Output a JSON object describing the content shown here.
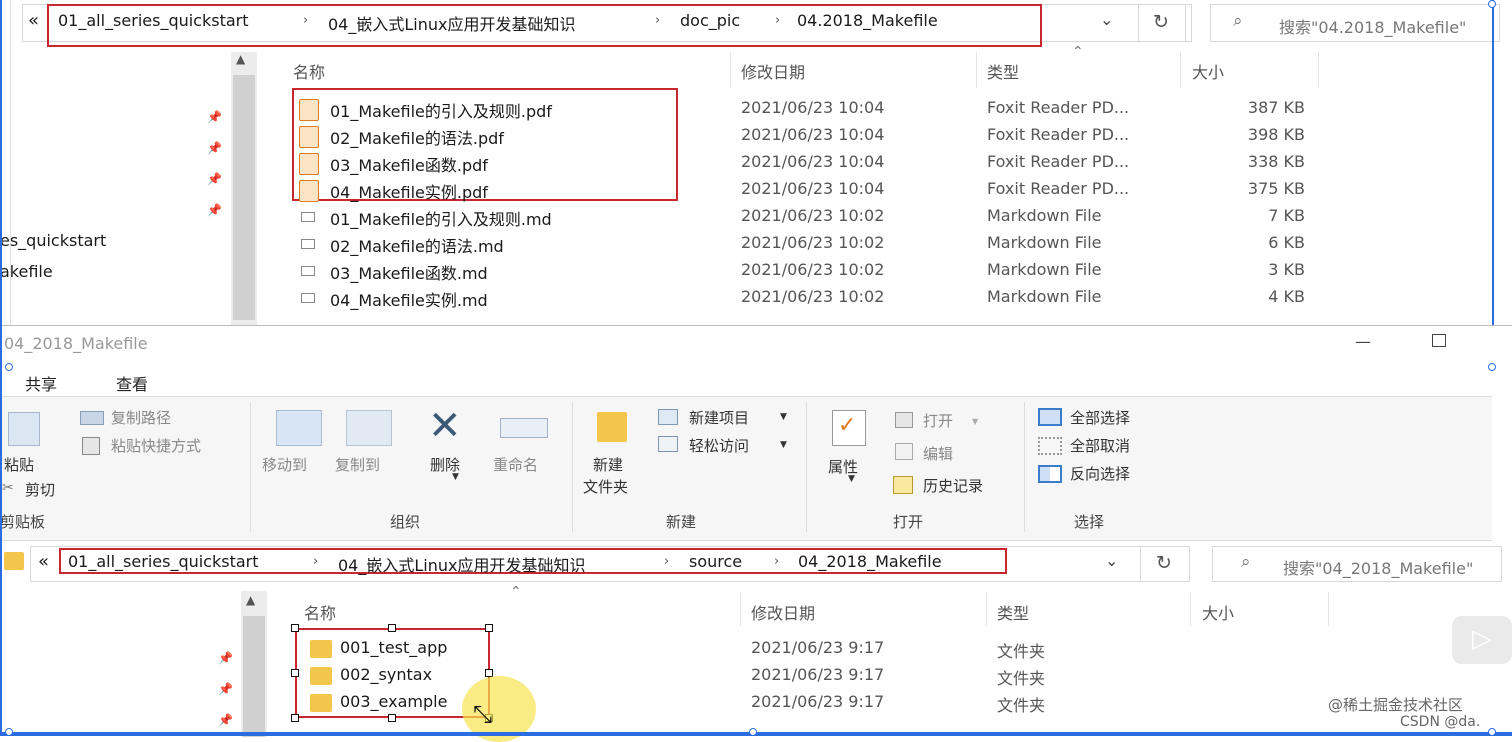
{
  "top": {
    "breadcrumb": [
      "01_all_series_quickstart",
      "04_嵌入式Linux应用开发基础知识",
      "doc_pic",
      "04.2018_Makefile"
    ],
    "back_chevrons": "«",
    "search_placeholder": "搜索\"04.2018_Makefile\"",
    "columns": {
      "name": "名称",
      "date": "修改日期",
      "type": "类型",
      "size": "大小"
    },
    "side_labels": [
      "es_quickstart",
      "akefile"
    ],
    "files": [
      {
        "name": "01_Makefile的引入及规则.pdf",
        "date": "2021/06/23 10:04",
        "type": "Foxit Reader PD...",
        "size": "387 KB",
        "icon": "pdf-icon"
      },
      {
        "name": "02_Makefile的语法.pdf",
        "date": "2021/06/23 10:04",
        "type": "Foxit Reader PD...",
        "size": "398 KB",
        "icon": "pdf-icon"
      },
      {
        "name": "03_Makefile函数.pdf",
        "date": "2021/06/23 10:04",
        "type": "Foxit Reader PD...",
        "size": "338 KB",
        "icon": "pdf-icon"
      },
      {
        "name": "04_Makefile实例.pdf",
        "date": "2021/06/23 10:04",
        "type": "Foxit Reader PD...",
        "size": "375 KB",
        "icon": "pdf-icon"
      },
      {
        "name": "01_Makefile的引入及规则.md",
        "date": "2021/06/23 10:02",
        "type": "Markdown File",
        "size": "7 KB",
        "icon": "md-icon"
      },
      {
        "name": "02_Makefile的语法.md",
        "date": "2021/06/23 10:02",
        "type": "Markdown File",
        "size": "6 KB",
        "icon": "md-icon"
      },
      {
        "name": "03_Makefile函数.md",
        "date": "2021/06/23 10:02",
        "type": "Markdown File",
        "size": "3 KB",
        "icon": "md-icon"
      },
      {
        "name": "04_Makefile实例.md",
        "date": "2021/06/23 10:02",
        "type": "Markdown File",
        "size": "4 KB",
        "icon": "md-icon"
      }
    ]
  },
  "bottom": {
    "window_title": "04_2018_Makefile",
    "tabs": [
      "共享",
      "查看"
    ],
    "ribbon": {
      "clipboard": {
        "copy_path": "复制路径",
        "paste_shortcut": "粘贴快捷方式",
        "paste": "粘贴",
        "cut": "剪切",
        "group": "剪贴板"
      },
      "organize": {
        "move_to": "移动到",
        "copy_to": "复制到",
        "delete": "删除",
        "rename": "重命名",
        "group": "组织"
      },
      "new": {
        "new_item": "新建项目",
        "easy_access": "轻松访问",
        "new_folder_1": "新建",
        "new_folder_2": "文件夹",
        "group": "新建"
      },
      "open": {
        "properties": "属性",
        "open": "打开",
        "edit": "编辑",
        "history": "历史记录",
        "group": "打开"
      },
      "select": {
        "select_all": "全部选择",
        "select_none": "全部取消",
        "invert": "反向选择",
        "group": "选择"
      }
    },
    "breadcrumb": [
      "01_all_series_quickstart",
      "04_嵌入式Linux应用开发基础知识",
      "source",
      "04_2018_Makefile"
    ],
    "back_chevrons": "«",
    "search_placeholder": "搜索\"04_2018_Makefile\"",
    "columns": {
      "name": "名称",
      "date": "修改日期",
      "type": "类型",
      "size": "大小"
    },
    "folders": [
      {
        "name": "001_test_app",
        "date": "2021/06/23 9:17",
        "type": "文件夹"
      },
      {
        "name": "002_syntax",
        "date": "2021/06/23 9:17",
        "type": "文件夹"
      },
      {
        "name": "003_example",
        "date": "2021/06/23 9:17",
        "type": "文件夹"
      }
    ]
  },
  "watermark": {
    "line1": "@稀土掘金技术社区",
    "line2": "CSDN @da."
  },
  "colors": {
    "accent_border": "#c8282d",
    "selection_handle": "#2a6de0",
    "folder": "#f3c54a",
    "pdf": "#e07a1f"
  }
}
